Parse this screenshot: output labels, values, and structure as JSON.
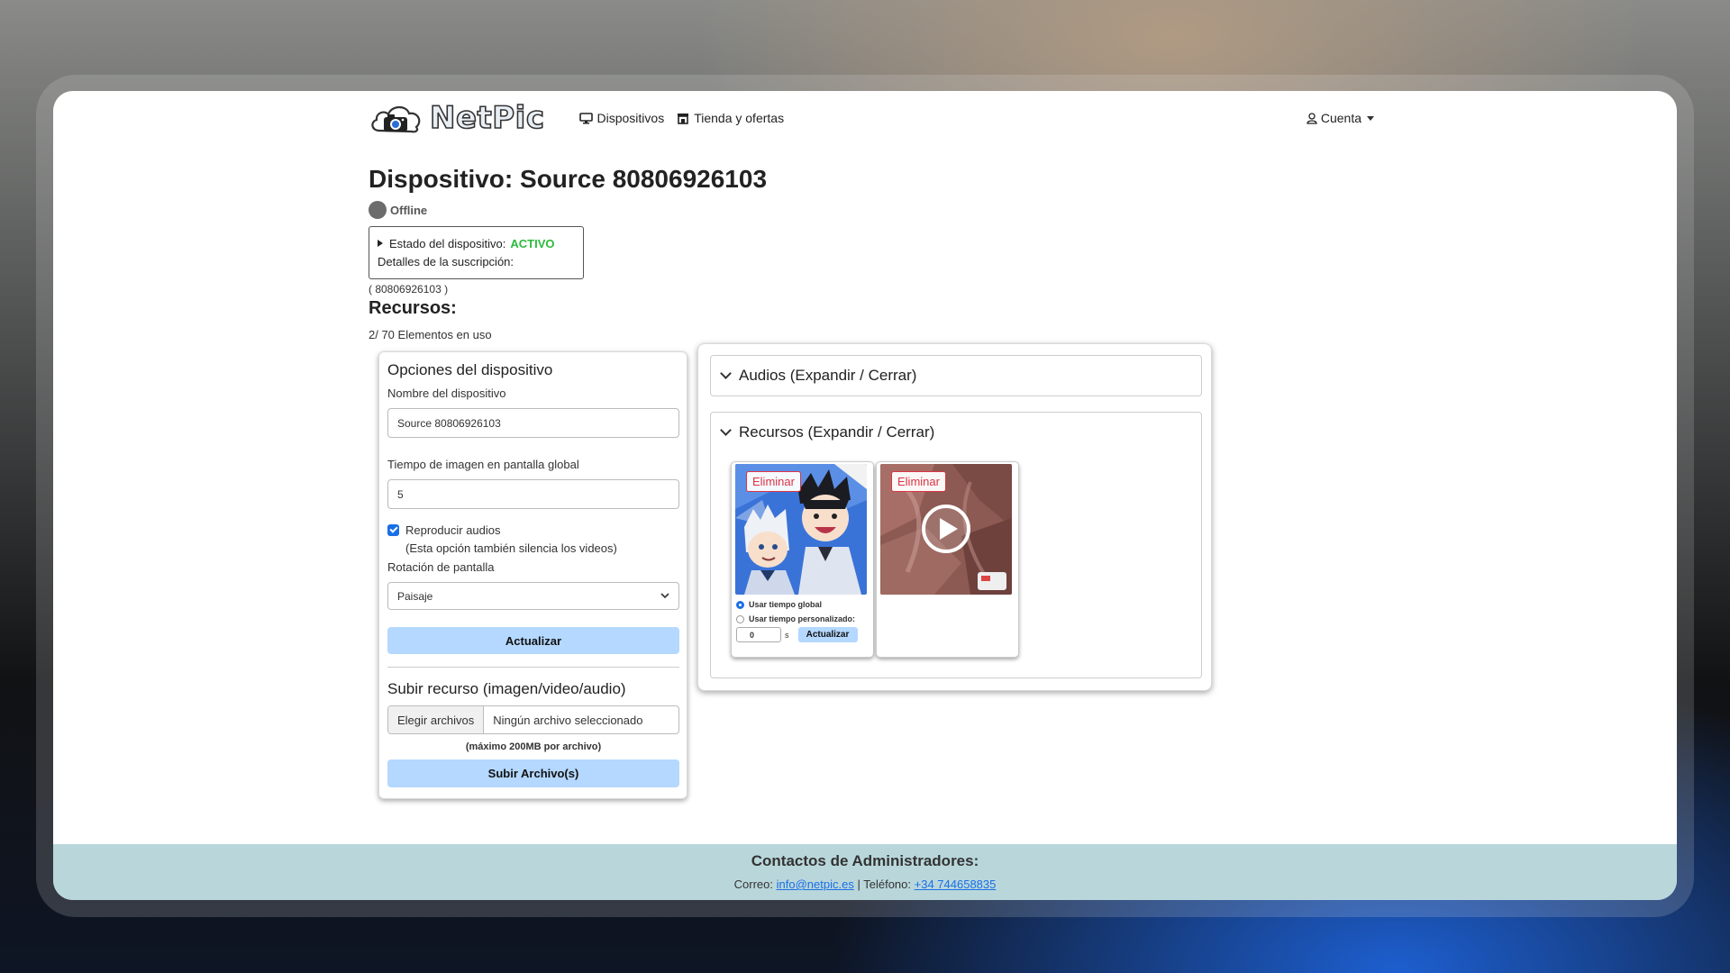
{
  "nav": {
    "brand": "NetPic",
    "links": [
      {
        "label": "Dispositivos",
        "icon": "monitor-icon"
      },
      {
        "label": "Tienda y ofertas",
        "icon": "store-icon"
      }
    ],
    "account_label": "Cuenta"
  },
  "device": {
    "title": "Dispositivo: Source 80806926103",
    "status": "Offline",
    "state_label": "Estado del dispositivo:",
    "state_value": "ACTIVO",
    "subscription_label": "Detalles de la suscripción:",
    "id_text": "( 80806926103 )"
  },
  "resources": {
    "heading": "Recursos:",
    "usage": "2/ 70 Elementos en uso"
  },
  "options": {
    "title": "Opciones del dispositivo",
    "name_label": "Nombre del dispositivo",
    "name_value": "Source 80806926103",
    "time_label": "Tiempo de imagen en pantalla global",
    "time_value": "5",
    "audio_checkbox_label": "Reproducir audios",
    "audio_checked": true,
    "audio_note": "(Esta opción también silencia los videos)",
    "rotation_label": "Rotación de pantalla",
    "rotation_value": "Paisaje",
    "update_button": "Actualizar"
  },
  "upload": {
    "title": "Subir recurso (imagen/video/audio)",
    "choose_button": "Elegir archivos",
    "no_file_text": "Ningún archivo seleccionado",
    "max_size_note": "(máximo 200MB por archivo)",
    "submit_button": "Subir Archivo(s)"
  },
  "panels": {
    "audios_header": "Audios (Expandir / Cerrar)",
    "resources_header": "Recursos (Expandir / Cerrar)"
  },
  "resource_items": [
    {
      "type": "image",
      "delete_label": "Eliminar",
      "radio_global": "Usar tiempo global",
      "radio_custom": "Usar tiempo personalizado:",
      "custom_time": "0",
      "unit": "s",
      "update_button": "Actualizar",
      "selected": "global"
    },
    {
      "type": "video",
      "delete_label": "Eliminar"
    }
  ],
  "footer": {
    "title": "Contactos de Administradores:",
    "email_label": "Correo:",
    "email": "info@netpic.es",
    "separator": "|",
    "phone_label": "Teléfono:",
    "phone": "+34 744658835"
  },
  "colors": {
    "accent_button": "#b4d8ff",
    "active_green": "#2bbb3b",
    "danger": "#dc3545",
    "footer_bg": "#b9d7db",
    "link": "#1a6fe6"
  }
}
